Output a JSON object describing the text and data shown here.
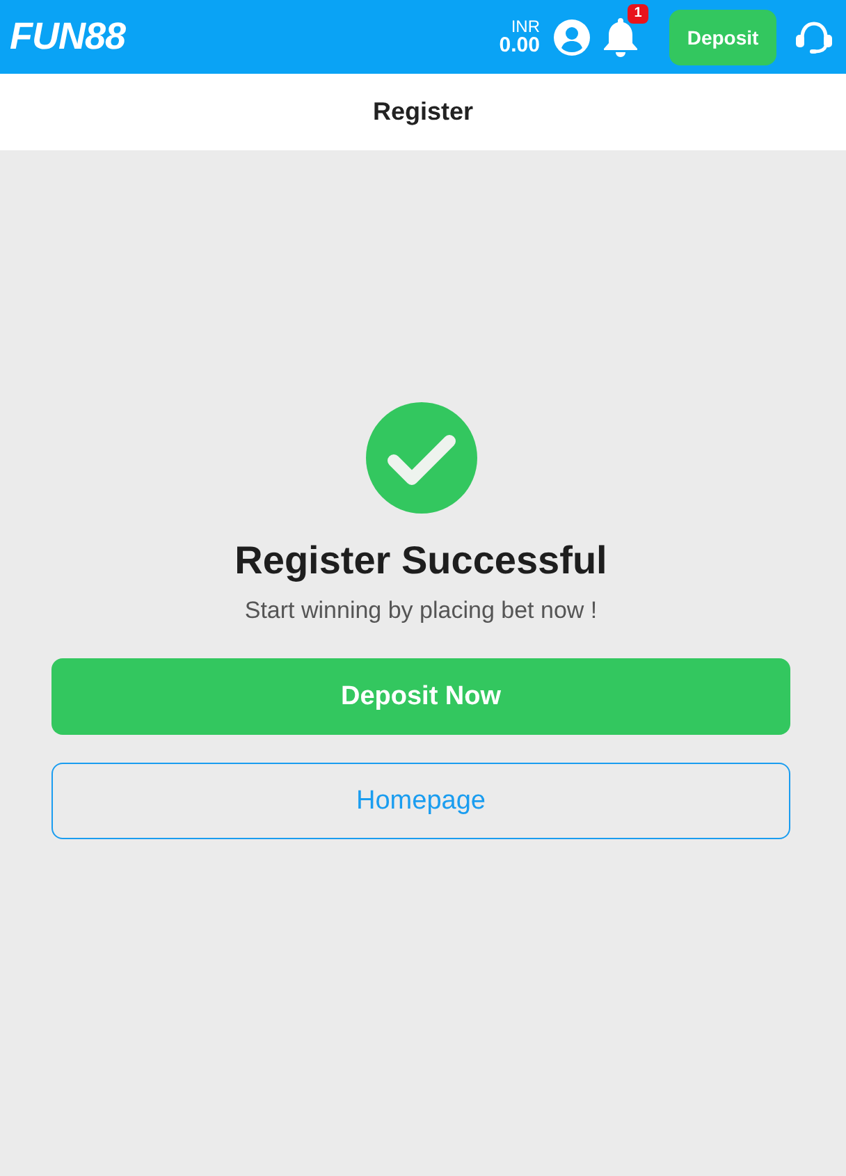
{
  "header": {
    "logo": "FUN88",
    "balance": {
      "currency": "INR",
      "amount": "0.00"
    },
    "notifications": {
      "badge": "1"
    },
    "deposit_button": "Deposit"
  },
  "title_bar": {
    "title": "Register"
  },
  "success": {
    "heading": "Register Successful",
    "message": "Start winning by placing bet now !"
  },
  "buttons": [
    {
      "kind": "primary",
      "label": "Deposit Now"
    },
    {
      "kind": "outline",
      "label": "Homepage"
    }
  ]
}
